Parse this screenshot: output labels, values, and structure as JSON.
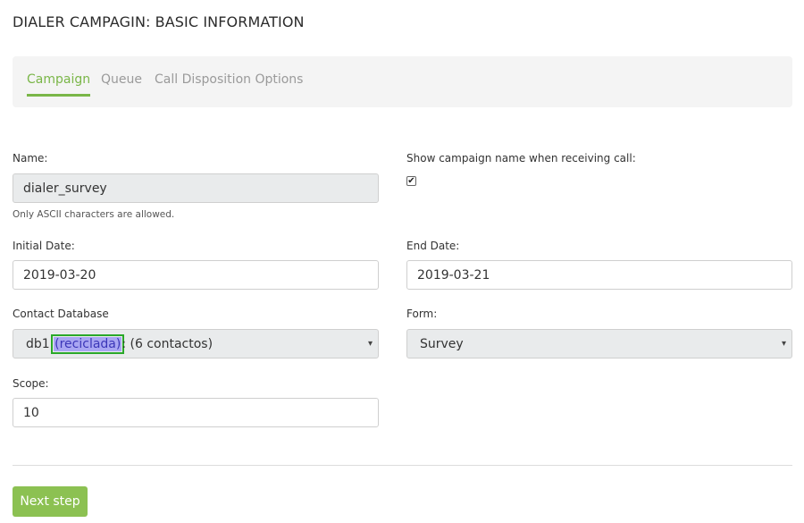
{
  "page": {
    "title": "DIALER CAMPAGIN: BASIC INFORMATION"
  },
  "tabs": [
    {
      "label": "Campaign",
      "active": true
    },
    {
      "label": "Queue",
      "active": false
    },
    {
      "label": "Call Disposition Options",
      "active": false
    }
  ],
  "form": {
    "name": {
      "label": "Name:",
      "value": "dialer_survey",
      "hint": "Only ASCII characters are allowed."
    },
    "show_campaign_name": {
      "label": "Show campaign name when receiving call:",
      "checked": true,
      "check_glyph": "✔"
    },
    "initial_date": {
      "label": "Initial Date:",
      "value": "2019-03-20"
    },
    "end_date": {
      "label": "End Date:",
      "value": "2019-03-21"
    },
    "contact_database": {
      "label": "Contact Database",
      "selected_prefix": "db1 ",
      "selected_highlight": "(reciclada)",
      "selected_suffix": ": (6 contactos)"
    },
    "form_select": {
      "label": "Form:",
      "selected": "Survey"
    },
    "scope": {
      "label": "Scope:",
      "value": "10"
    }
  },
  "icons": {
    "select_caret": "▾",
    "checkbox": "checkmark-icon"
  },
  "footer": {
    "next_label": "Next step"
  },
  "colors": {
    "accent": "#7ab648",
    "button": "#8cc152",
    "highlight": "#a9a6f2",
    "highlight_outline": "#2aa82a"
  }
}
